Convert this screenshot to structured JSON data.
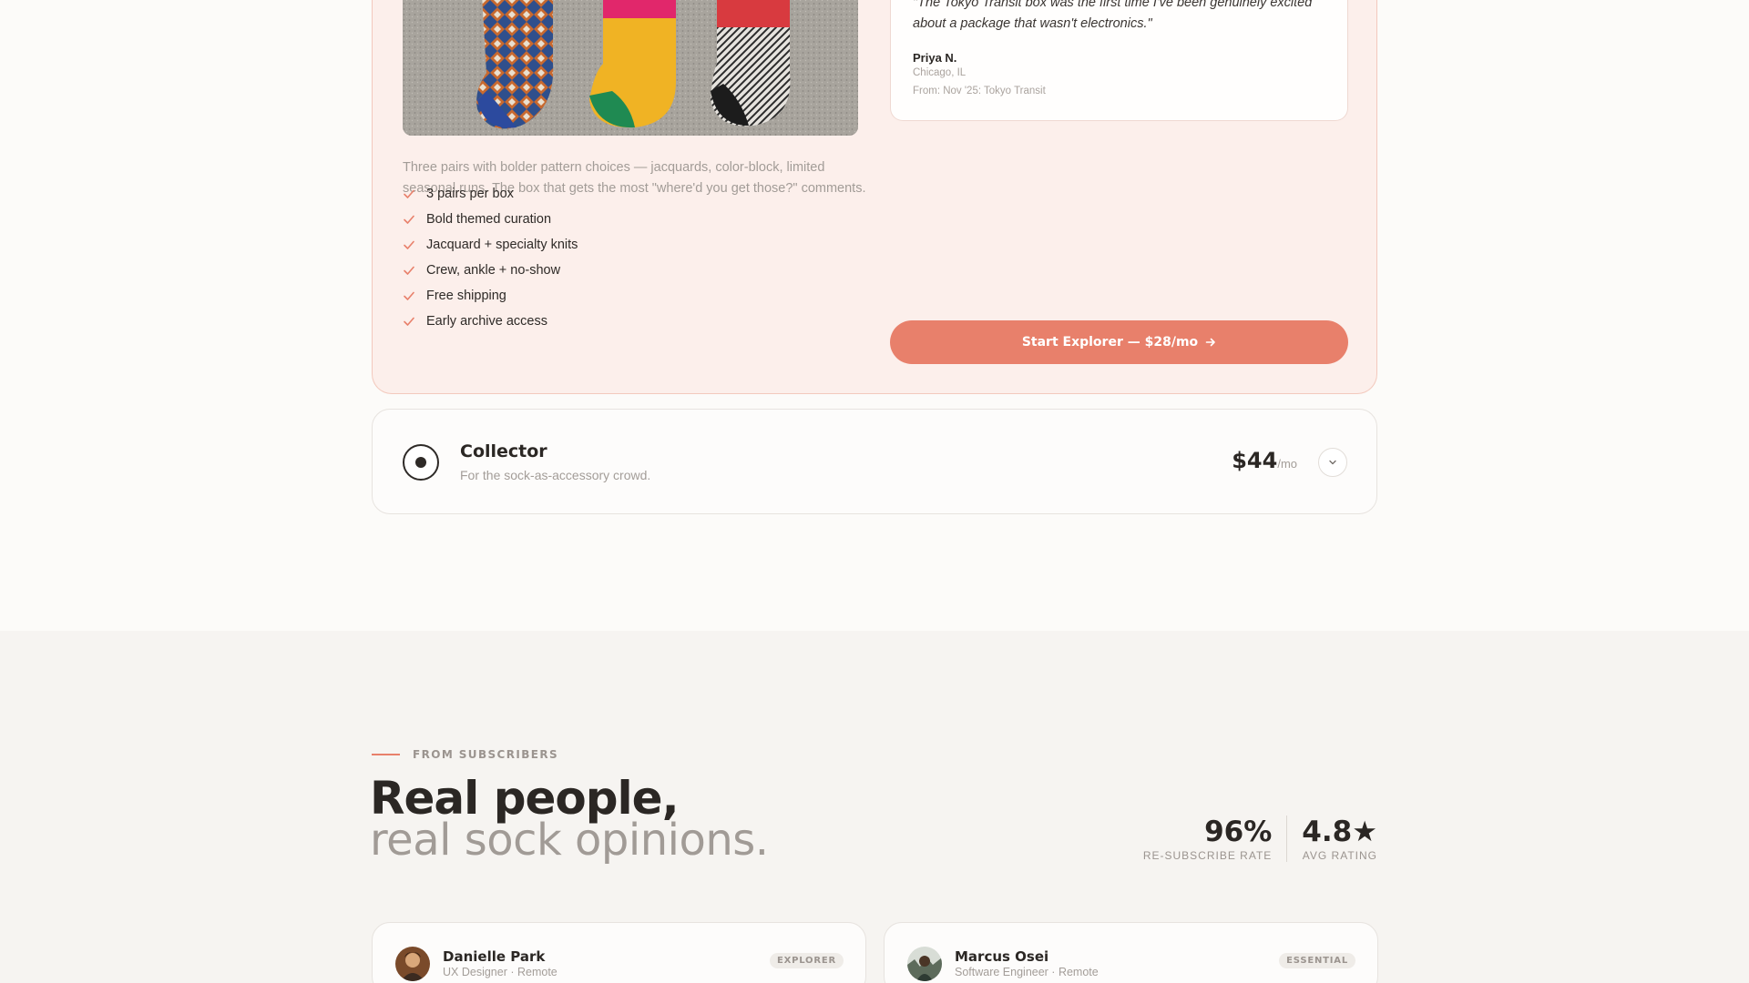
{
  "explorer": {
    "description": "Three pairs with bolder pattern choices — jacquards, color-block, limited seasonal runs. The box that gets the most \"where'd you get those?\" comments.",
    "features": [
      "3 pairs per box",
      "Bold themed curation",
      "Jacquard + specialty knits",
      "Crew, ankle + no-show",
      "Free shipping",
      "Early archive access"
    ],
    "testimonial": {
      "quote": "\"The Tokyo Transit box was the first time I've been genuinely excited about a package that wasn't electronics.\"",
      "name": "Priya N.",
      "location": "Chicago, IL",
      "from": "From: Nov '25: Tokyo Transit"
    },
    "cta_label": "Start Explorer — $28/mo",
    "cta_icon": "arrow-right-icon",
    "check_icon": "check-icon",
    "accent_color": "#e8806b"
  },
  "collector": {
    "name": "Collector",
    "tagline": "For the sock-as-accessory crowd.",
    "price": "$44",
    "period": "/mo",
    "expand_icon": "chevron-down-icon"
  },
  "subscribers": {
    "eyebrow": "FROM SUBSCRIBERS",
    "heading_line1": "Real people,",
    "heading_line2": "real sock opinions.",
    "stats": [
      {
        "value": "96%",
        "label": "RE-SUBSCRIBE RATE"
      },
      {
        "value": "4.8★",
        "label": "AVG RATING"
      }
    ],
    "reviews": [
      {
        "name": "Danielle Park",
        "role": "UX Designer · Remote",
        "badge": "EXPLORER"
      },
      {
        "name": "Marcus Osei",
        "role": "Software Engineer · Remote",
        "badge": "ESSENTIAL"
      }
    ]
  }
}
